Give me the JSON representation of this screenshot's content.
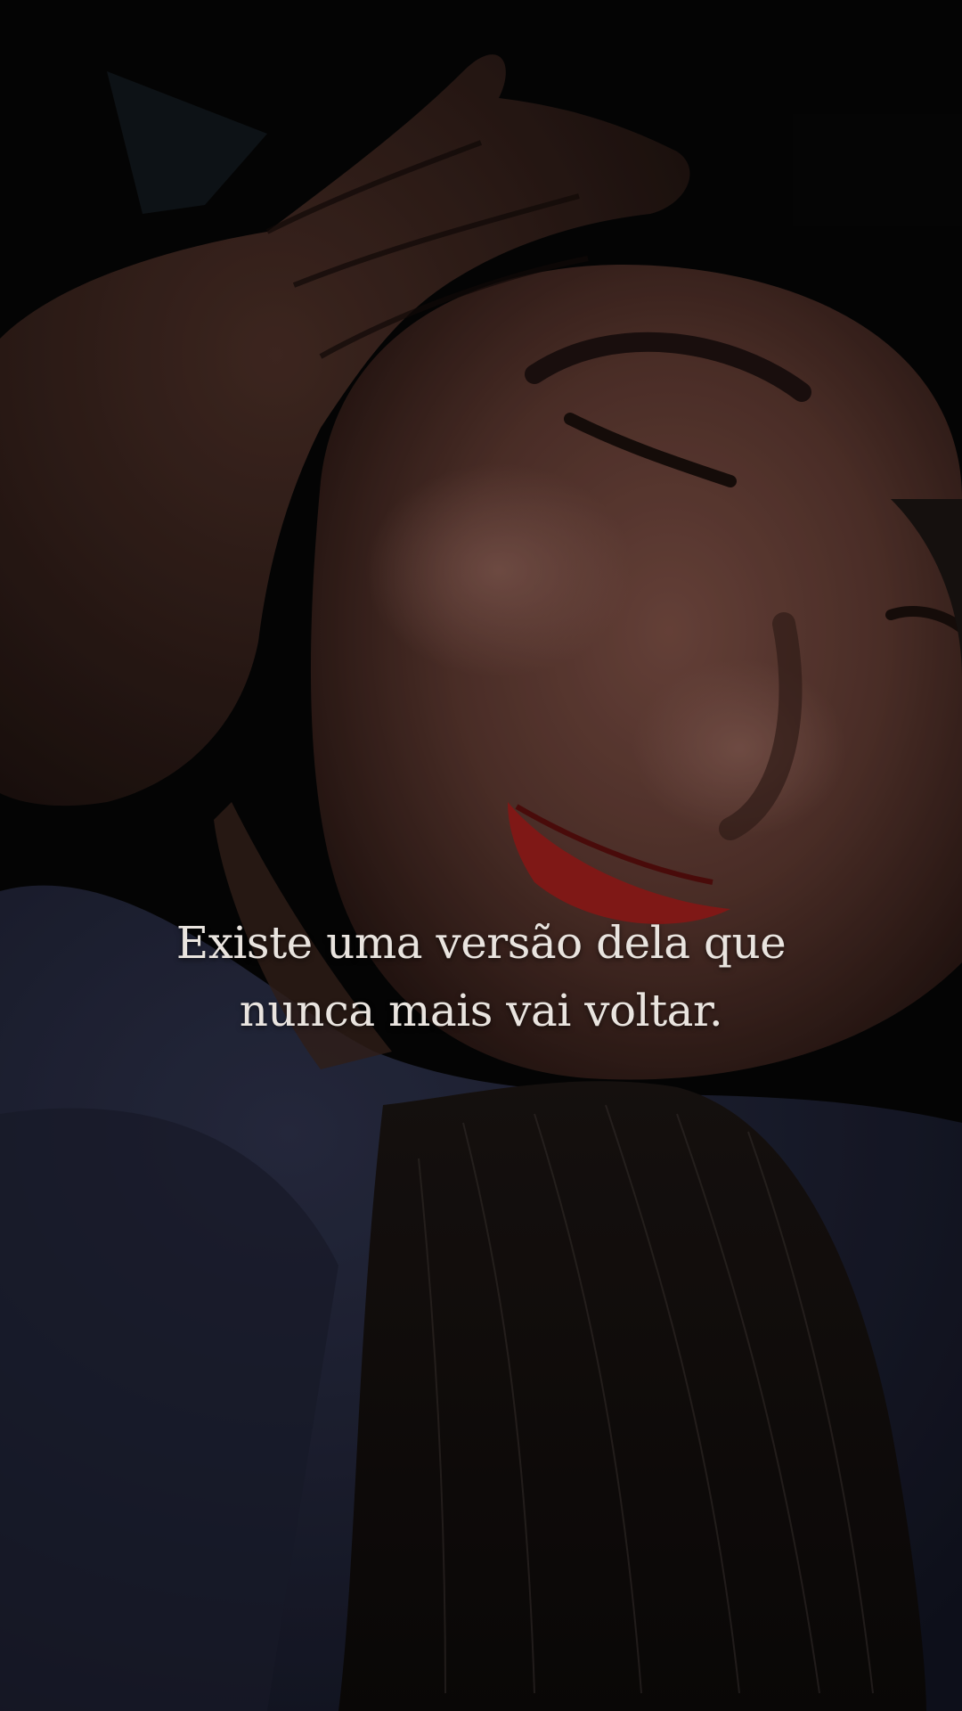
{
  "caption": {
    "line1": "Existe uma versão dela que",
    "line2": "nunca mais vai voltar."
  },
  "colors": {
    "background": "#060606",
    "caption_text": "#e9e4df",
    "lipstick": "#a31c1c",
    "sweater": "#23263a",
    "skin": "#6a4238"
  }
}
